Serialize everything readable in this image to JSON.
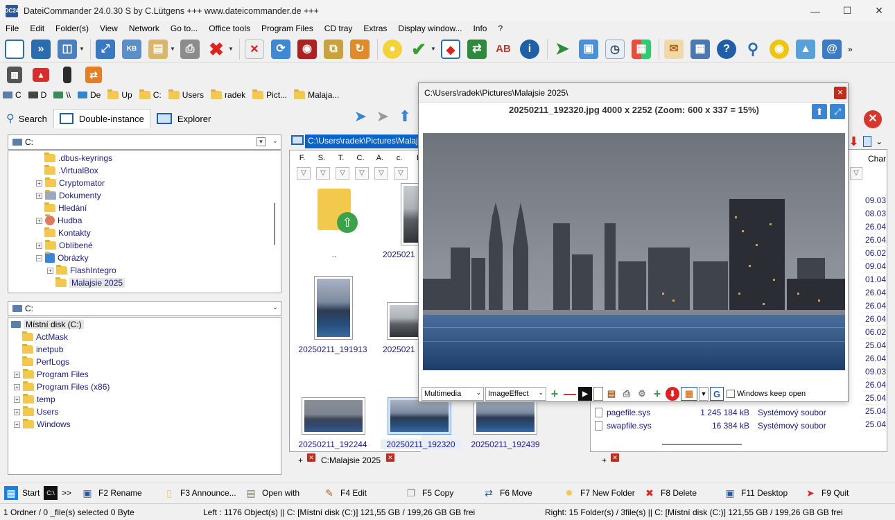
{
  "window": {
    "title": "DateiCommander 24.0.30 S   by C.Lütgens +++ www.dateicommander.de +++",
    "app_icon_text": "DC24"
  },
  "menu": [
    "File",
    "Edit",
    "Folder(s)",
    "View",
    "Network",
    "Go to...",
    "Office tools",
    "Program Files",
    "CD tray",
    "Extras",
    "Display window...",
    "Info",
    "?"
  ],
  "drivebar": {
    "items": [
      "C",
      "D",
      "\\\\",
      "De",
      "Up",
      "C:",
      "Users",
      "radek",
      "Pict...",
      "Malaja..."
    ]
  },
  "tabs": {
    "search": "Search",
    "double": "Double-instance",
    "explorer": "Explorer"
  },
  "left_top_tree": {
    "drive": "C:",
    "rows": [
      ".dbus-keyrings",
      ".VirtualBox",
      "Cryptomator",
      "Dokumenty",
      "Hledání",
      "Hudba",
      "Kontakty",
      "Oblíbené",
      "Obrázky",
      "FlashIntegro",
      "Malajsie 2025"
    ]
  },
  "left_bottom_tree": {
    "drive": "C:",
    "root": "Místní disk (C:)",
    "rows": [
      "ActMask",
      "inetpub",
      "PerfLogs",
      "Program Files",
      "Program Files (x86)",
      "temp",
      "Users",
      "Windows"
    ]
  },
  "middle": {
    "path": "C:\\Users\\radek\\Pictures\\Malajsie 2025",
    "columns": [
      "F.",
      "S.",
      "T.",
      "C.",
      "A.",
      "c.",
      "L"
    ],
    "thumbs": [
      "..",
      "2025021",
      "20250211_191913",
      "2025021",
      "20250211_192244",
      "20250211_192320",
      "20250211_192439"
    ],
    "bottom_tab": "C:Malajsie 2025",
    "add_tab": "+"
  },
  "right": {
    "col_header": "Char",
    "dates": [
      "09.03",
      "08.03",
      "26.04",
      "26.04",
      "06.02",
      "09.04",
      "01.04",
      "26.04",
      "26.04",
      "26.04",
      "06.02",
      "25.04",
      "26.04",
      "09.03",
      "26.04",
      "25.04",
      "25.04",
      "25.04"
    ],
    "files": [
      {
        "name": "pagefile.sys",
        "size": "1 245 184 kB",
        "type": "Systémový soubor"
      },
      {
        "name": "swapfile.sys",
        "size": "16 384 kB",
        "type": "Systémový soubor"
      }
    ],
    "add_tab": "+"
  },
  "viewer": {
    "title": "C:\\Users\\radek\\Pictures\\Malajsie 2025\\",
    "info": "20250211_192320.jpg 4000 x 2252 (Zoom: 600 x 337 = 15%)",
    "multimedia": "Multimedia",
    "effect": "ImageEffect",
    "keep_open": "Windows keep open"
  },
  "fnbar": [
    {
      "key": "start",
      "label": "Start"
    },
    {
      "key": "cmd",
      "label": ">>"
    },
    {
      "key": "f2",
      "label": "F2 Rename"
    },
    {
      "key": "f3",
      "label": "F3 Announce..."
    },
    {
      "key": "openwith",
      "label": "Open with"
    },
    {
      "key": "f4",
      "label": "F4 Edit"
    },
    {
      "key": "f5",
      "label": "F5 Copy"
    },
    {
      "key": "f6",
      "label": "F6 Move"
    },
    {
      "key": "f7",
      "label": "F7 New Folder"
    },
    {
      "key": "f8",
      "label": "F8 Delete"
    },
    {
      "key": "f11",
      "label": "F11 Desktop"
    },
    {
      "key": "f9",
      "label": "F9 Quit"
    }
  ],
  "status": {
    "selection": "1 Ordner / 0 _file(s) selected 0 Byte",
    "left": "Left : 1176 Object(s)  ||  C: [Místní disk (C:)]   121,55 GB  / 199,26 GB  GB frei",
    "right": "Right: 15 Folder(s) / 3file(s)  ||  C: [Místní disk (C:)]   121,55 GB  / 199,26 GB  GB frei"
  },
  "colors": {
    "accent": "#0a63c9",
    "close_red": "#c42b1c",
    "link_text": "#1a1a8c"
  }
}
